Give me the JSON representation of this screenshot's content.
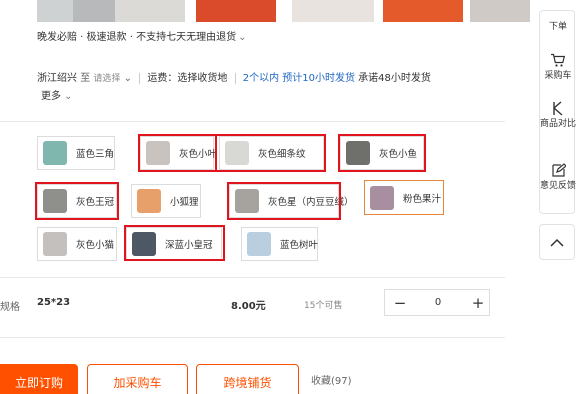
{
  "service": {
    "text": "晚发必赔 · 极速退款 · 不支持七天无理由退货",
    "chevron": "chevron-down-icon"
  },
  "shipping": {
    "origin": "浙江绍兴",
    "to_word": "至",
    "select_placeholder": "请选择",
    "fee_text": "运费：选择收货地",
    "ship_time": "2个以内 预计10小时发货",
    "promise": "承诺48小时发货",
    "more": "更多"
  },
  "variants": [
    {
      "label": "蓝色三角",
      "color": "#7fb7ae",
      "selected": false
    },
    {
      "label": "灰色小叶",
      "color": "#c9c3c0",
      "selected": false
    },
    {
      "label": "灰色细条纹",
      "color": "#d8d8d4",
      "selected": false
    },
    {
      "label": "灰色小鱼",
      "color": "#6f6f6b",
      "selected": false
    },
    {
      "label": "灰色王冠",
      "color": "#8f8f8c",
      "selected": false
    },
    {
      "label": "小狐狸",
      "color": "#e8a06a",
      "selected": false
    },
    {
      "label": "灰色星（内豆豆绒）",
      "color": "#a6a39f",
      "selected": false
    },
    {
      "label": "粉色果汁",
      "color": "#a88f9f",
      "selected": true
    },
    {
      "label": "灰色小猫",
      "color": "#c4c0bd",
      "selected": false
    },
    {
      "label": "深蓝小皇冠",
      "color": "#4e5764",
      "selected": false
    },
    {
      "label": "蓝色树叶",
      "color": "#b9cfe0",
      "selected": false
    }
  ],
  "spec": {
    "label": "规格",
    "value": "25*23",
    "price": "8.00元",
    "stock": "15个可售",
    "quantity": "0",
    "minus": "−",
    "plus": "+"
  },
  "actions": {
    "order": "立即订购",
    "cart": "加采购车",
    "buy": "跨境铺货",
    "favorite": "收藏(97)"
  },
  "sidebar": {
    "order_label": "下单",
    "cart_label": "采购车",
    "compare_label": "商品对比",
    "feedback_label": "意见反馈"
  }
}
